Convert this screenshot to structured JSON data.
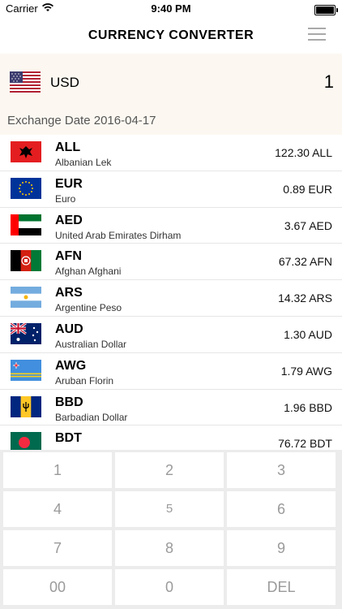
{
  "status": {
    "carrier": "Carrier",
    "time": "9:40 PM"
  },
  "header": {
    "title": "CURRENCY CONVERTER"
  },
  "base": {
    "code": "USD",
    "amount": "1",
    "exchange_date": "Exchange Date 2016-04-17"
  },
  "currencies": [
    {
      "code": "ALL",
      "name": "Albanian Lek",
      "value": "122.30 ALL"
    },
    {
      "code": "EUR",
      "name": "Euro",
      "value": "0.89 EUR"
    },
    {
      "code": "AED",
      "name": "United Arab Emirates Dirham",
      "value": "3.67 AED"
    },
    {
      "code": "AFN",
      "name": "Afghan Afghani",
      "value": "67.32 AFN"
    },
    {
      "code": "ARS",
      "name": "Argentine Peso",
      "value": "14.32 ARS"
    },
    {
      "code": "AUD",
      "name": "Australian Dollar",
      "value": "1.30 AUD"
    },
    {
      "code": "AWG",
      "name": "Aruban Florin",
      "value": "1.79 AWG"
    },
    {
      "code": "BBD",
      "name": "Barbadian Dollar",
      "value": "1.96 BBD"
    },
    {
      "code": "BDT",
      "name": "",
      "value": "76.72 BDT"
    }
  ],
  "keypad": {
    "k1": "1",
    "k2": "2",
    "k3": "3",
    "k4": "4",
    "k5": "5",
    "k6": "6",
    "k7": "7",
    "k8": "8",
    "k9": "9",
    "k00": "00",
    "k0": "0",
    "kdel": "DEL"
  }
}
